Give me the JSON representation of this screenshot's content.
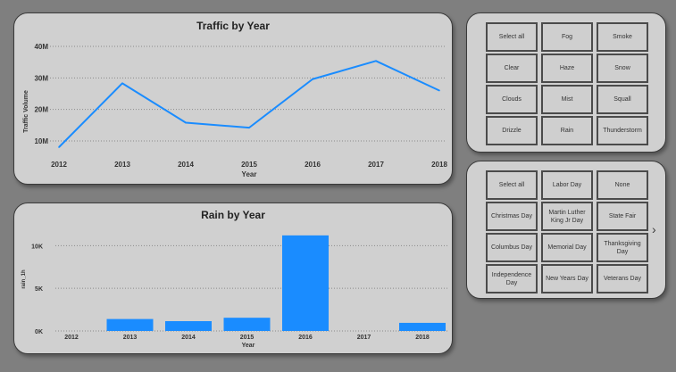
{
  "traffic_chart": {
    "title": "Traffic by Year",
    "ylabel": "Traffic Volume",
    "xlabel": "Year",
    "y_ticks": [
      "10M",
      "20M",
      "30M",
      "40M"
    ]
  },
  "rain_chart": {
    "title": "Rain by Year",
    "ylabel": "rain_1h",
    "xlabel": "Year",
    "y_ticks": [
      "0K",
      "5K",
      "10K"
    ]
  },
  "weather_slicer": {
    "items": [
      "Select all",
      "Fog",
      "Smoke",
      "Clear",
      "Haze",
      "Snow",
      "Clouds",
      "Mist",
      "Squall",
      "Drizzle",
      "Rain",
      "Thunderstorm"
    ]
  },
  "holiday_slicer": {
    "items": [
      "Select all",
      "Labor Day",
      "None",
      "Christmas Day",
      "Martin Luther King Jr Day",
      "State Fair",
      "Columbus Day",
      "Memorial Day",
      "Thanksgiving Day",
      "Independence Day",
      "New Years Day",
      "Veterans Day"
    ]
  },
  "colors": {
    "series": "#1a8cff",
    "panel": "#d0d0d0",
    "background": "#7f7f7f"
  },
  "chart_data": [
    {
      "type": "line",
      "title": "Traffic by Year",
      "xlabel": "Year",
      "ylabel": "Traffic Volume",
      "x": [
        "2012",
        "2013",
        "2014",
        "2015",
        "2016",
        "2017",
        "2018"
      ],
      "series": [
        {
          "values": [
            8000000,
            28300000,
            15800000,
            14200000,
            29600000,
            35400000,
            26000000
          ]
        }
      ],
      "ylim": [
        8000000,
        42000000
      ],
      "y_ticks": [
        10000000,
        20000000,
        30000000,
        40000000
      ],
      "grid": true
    },
    {
      "type": "bar",
      "title": "Rain by Year",
      "xlabel": "Year",
      "ylabel": "rain_1h",
      "categories": [
        "2012",
        "2013",
        "2014",
        "2015",
        "2016",
        "2017",
        "2018"
      ],
      "values": [
        0,
        1400,
        1150,
        1550,
        11200,
        0,
        950
      ],
      "ylim": [
        0,
        11500
      ],
      "y_ticks": [
        0,
        5000,
        10000
      ],
      "grid": true
    }
  ]
}
